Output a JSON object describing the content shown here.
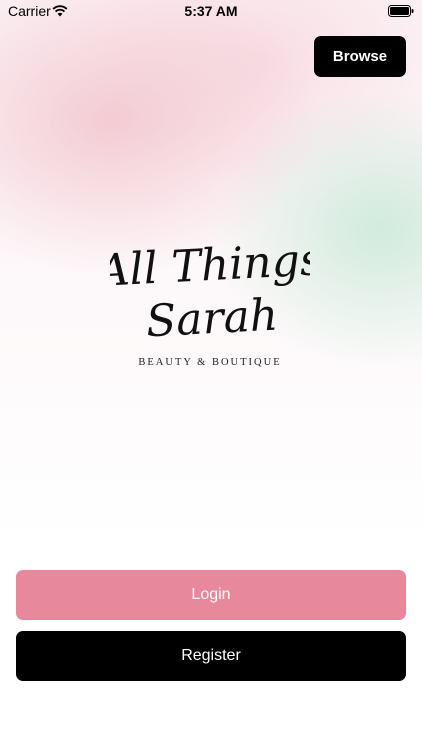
{
  "status_bar": {
    "carrier": "Carrier",
    "time": "5:37 AM",
    "icons": [
      "wifi-icon",
      "battery-icon"
    ]
  },
  "header": {
    "browse_label": "Browse"
  },
  "logo": {
    "line1": "All Things",
    "line2": "Sarah",
    "tagline": "BEAUTY & BOUTIQUE"
  },
  "actions": {
    "login_label": "Login",
    "register_label": "Register"
  },
  "colors": {
    "login_button": "#e7889c",
    "register_button": "#000000",
    "browse_button": "#000000",
    "background_pink": "#f0bec8",
    "background_green": "#bee6d2"
  }
}
